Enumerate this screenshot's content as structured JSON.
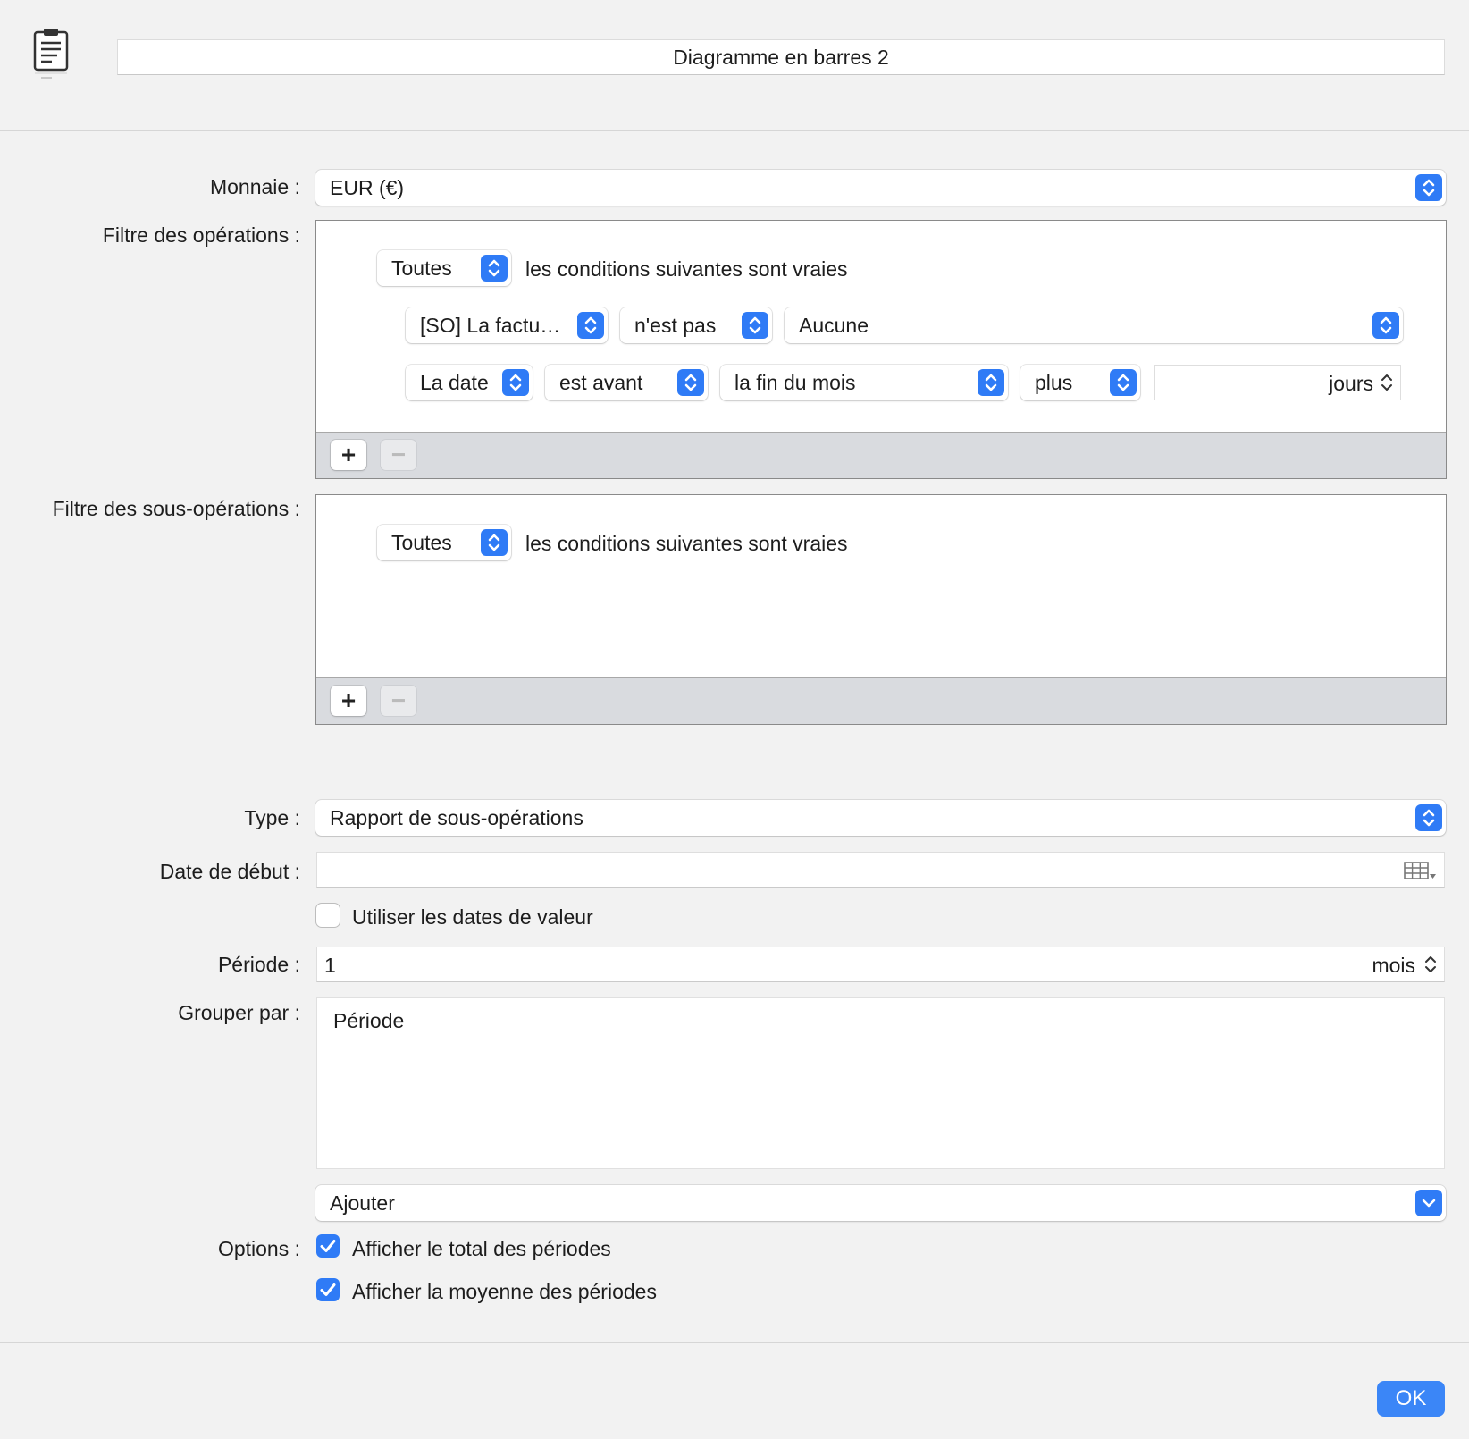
{
  "header": {
    "title": "Diagramme en barres 2",
    "icon": "clipboard-document-icon"
  },
  "currency": {
    "label": "Monnaie :",
    "value": "EUR (€)"
  },
  "transaction_filter": {
    "label": "Filtre des opérations :",
    "match_value": "Toutes",
    "match_suffix": "les conditions suivantes sont vraies",
    "rows": [
      {
        "field": "[SO] La factu…",
        "operator": "n'est pas",
        "value": "Aucune"
      },
      {
        "field": "La date",
        "operator": "est avant",
        "value": "la fin du mois",
        "modifier": "plus",
        "unit": "jours"
      }
    ]
  },
  "split_filter": {
    "label": "Filtre des sous-opérations :",
    "match_value": "Toutes",
    "match_suffix": "les conditions suivantes sont vraies"
  },
  "add_symbol": "+",
  "remove_symbol": "−",
  "type": {
    "label": "Type :",
    "value": "Rapport de sous-opérations"
  },
  "start_date": {
    "label": "Date de début :",
    "value": "",
    "icon": "calendar-grid-icon"
  },
  "value_dates": {
    "label": "Utiliser les dates de valeur",
    "checked": false
  },
  "period": {
    "label": "Période :",
    "value": "1",
    "unit": "mois"
  },
  "group_by": {
    "label": "Grouper par :",
    "items": [
      "Période"
    ],
    "add_label": "Ajouter"
  },
  "options": {
    "label": "Options :",
    "items": [
      {
        "label": "Afficher le total des périodes",
        "checked": true
      },
      {
        "label": "Afficher la moyenne des périodes",
        "checked": true
      }
    ]
  },
  "ok_label": "OK",
  "colors": {
    "accent": "#2f7bf6",
    "background": "#f2f2f2"
  }
}
